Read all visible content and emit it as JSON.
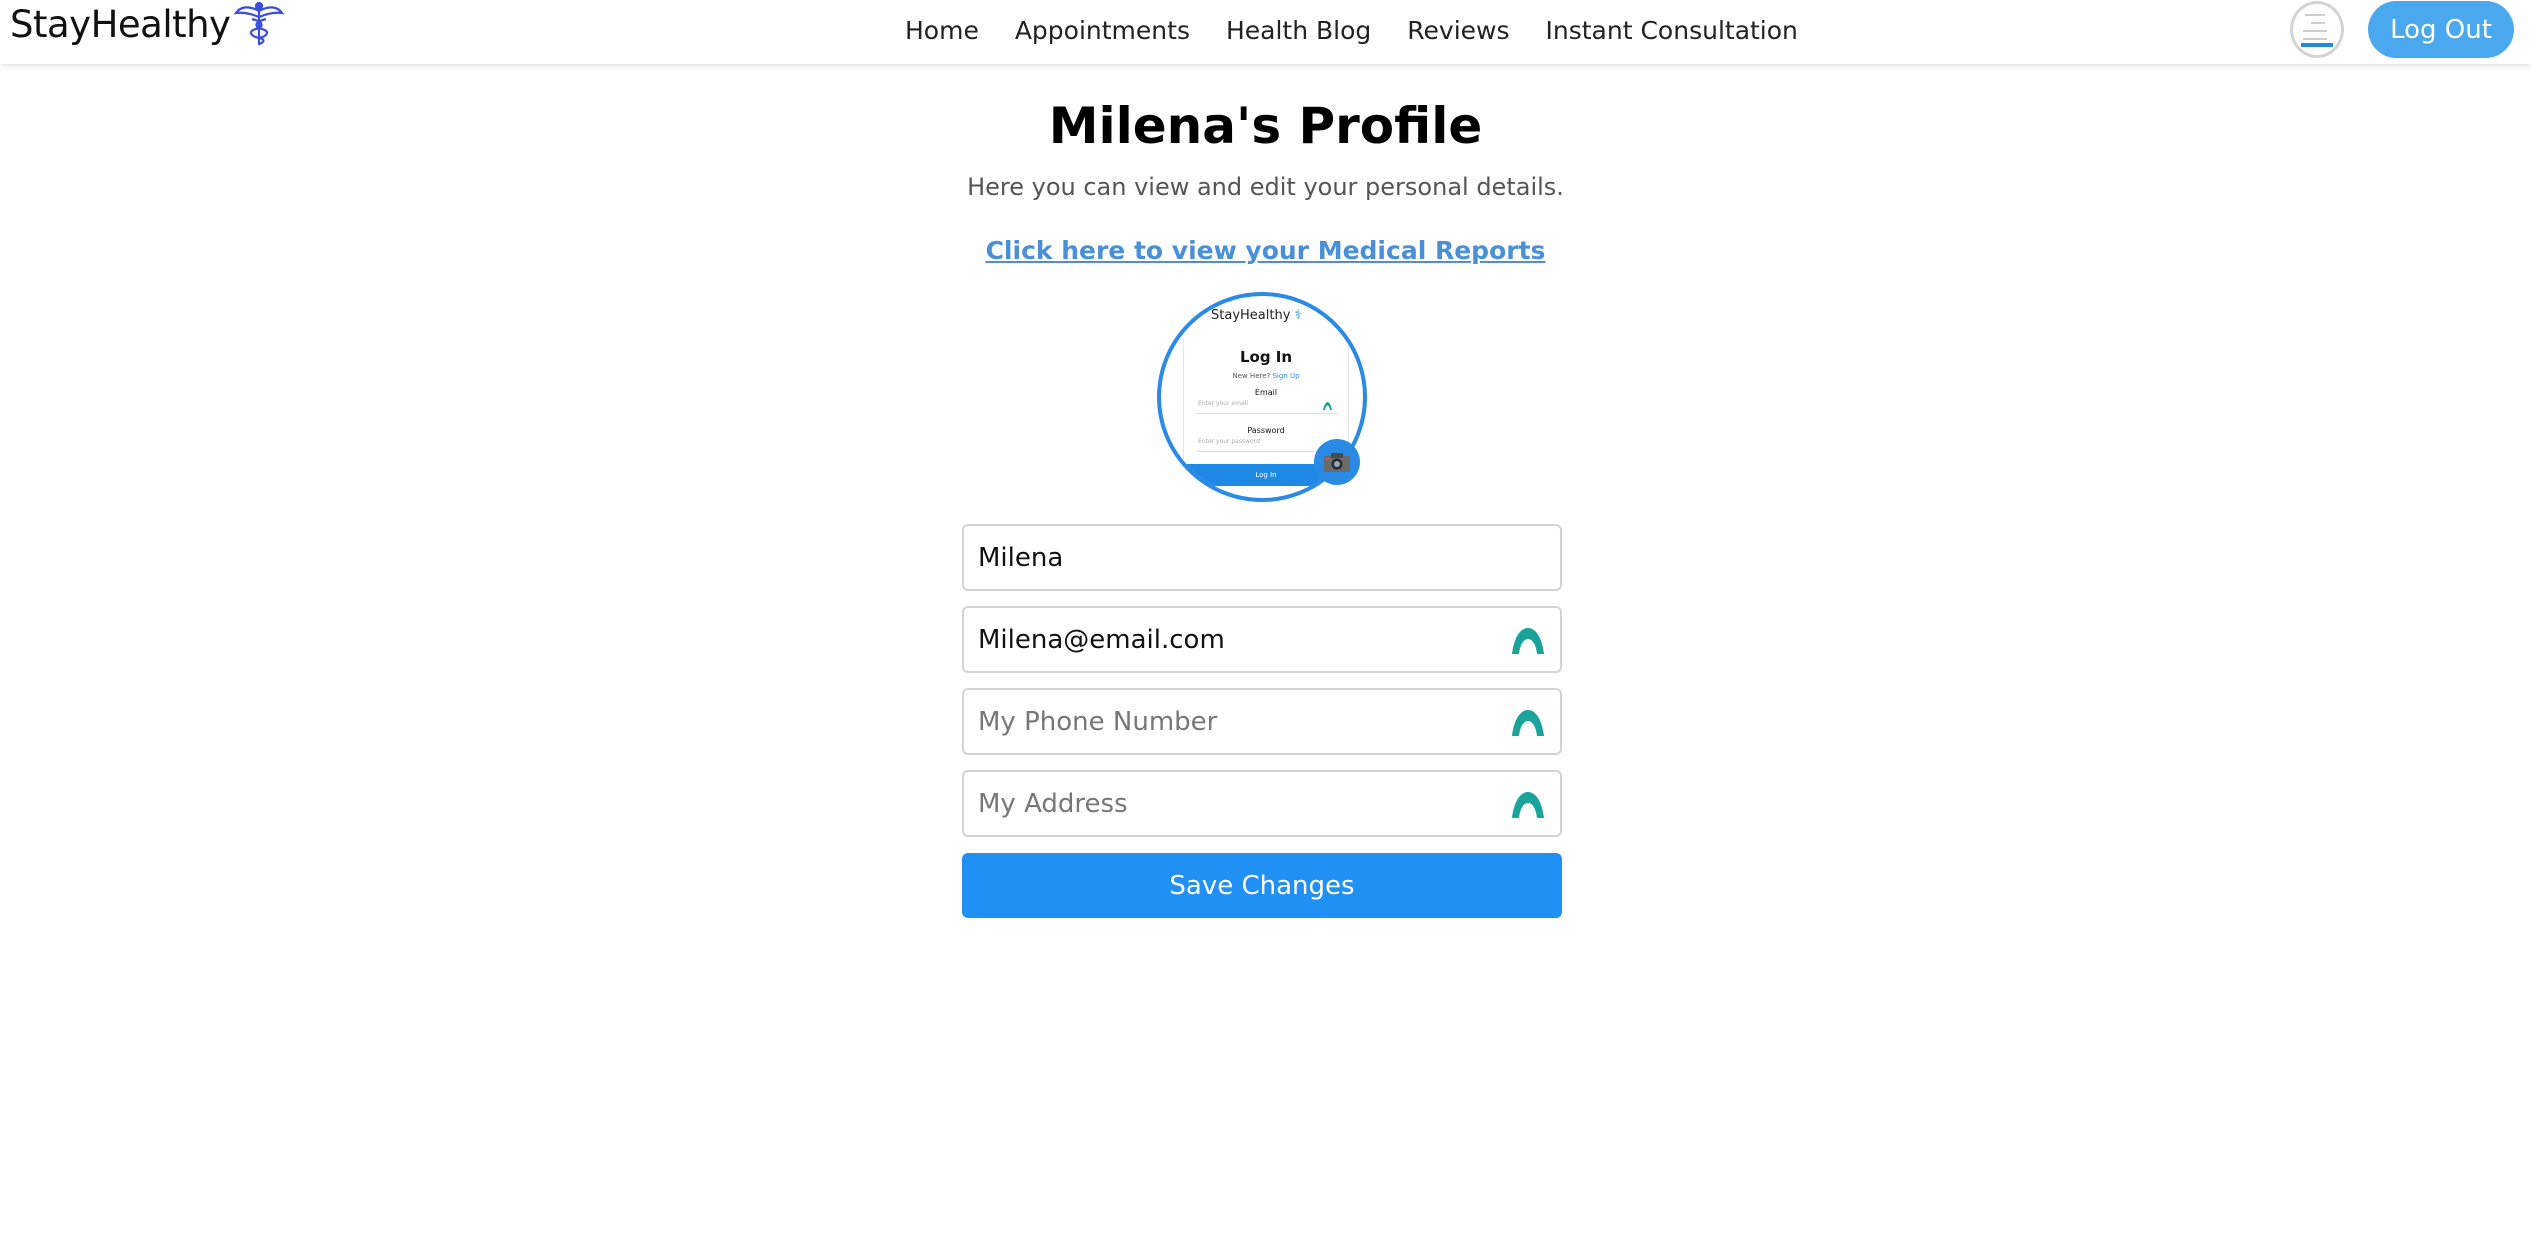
{
  "navbar": {
    "brand": "StayHealthy",
    "links": [
      "Home",
      "Appointments",
      "Health Blog",
      "Reviews",
      "Instant Consultation"
    ],
    "logout_label": "Log Out"
  },
  "profile": {
    "title": "Milena's Profile",
    "subtitle": "Here you can view and edit your personal details.",
    "reports_link": "Click here to view your Medical Reports"
  },
  "avatar_preview": {
    "brand": "StayHealthy",
    "heading": "Log In",
    "new_here": "New Here?",
    "signup": "Sign Up",
    "email_label": "Email",
    "email_placeholder": "Enter your email",
    "password_label": "Password",
    "password_placeholder": "Enter your password",
    "button": "Log In"
  },
  "form": {
    "name_value": "Milena",
    "email_value": "Milena@email.com",
    "phone_placeholder": "My Phone Number",
    "address_placeholder": "My Address",
    "save_label": "Save Changes"
  },
  "colors": {
    "accent": "#2090f5",
    "logout": "#4aa8ee",
    "link": "#4a90d9",
    "avatar_border": "#2b8ae6",
    "password_manager_icon": "#1aa39a"
  },
  "icons": {
    "brand": "caduceus-icon",
    "camera": "camera-icon",
    "field_autofill": "password-manager-icon"
  }
}
